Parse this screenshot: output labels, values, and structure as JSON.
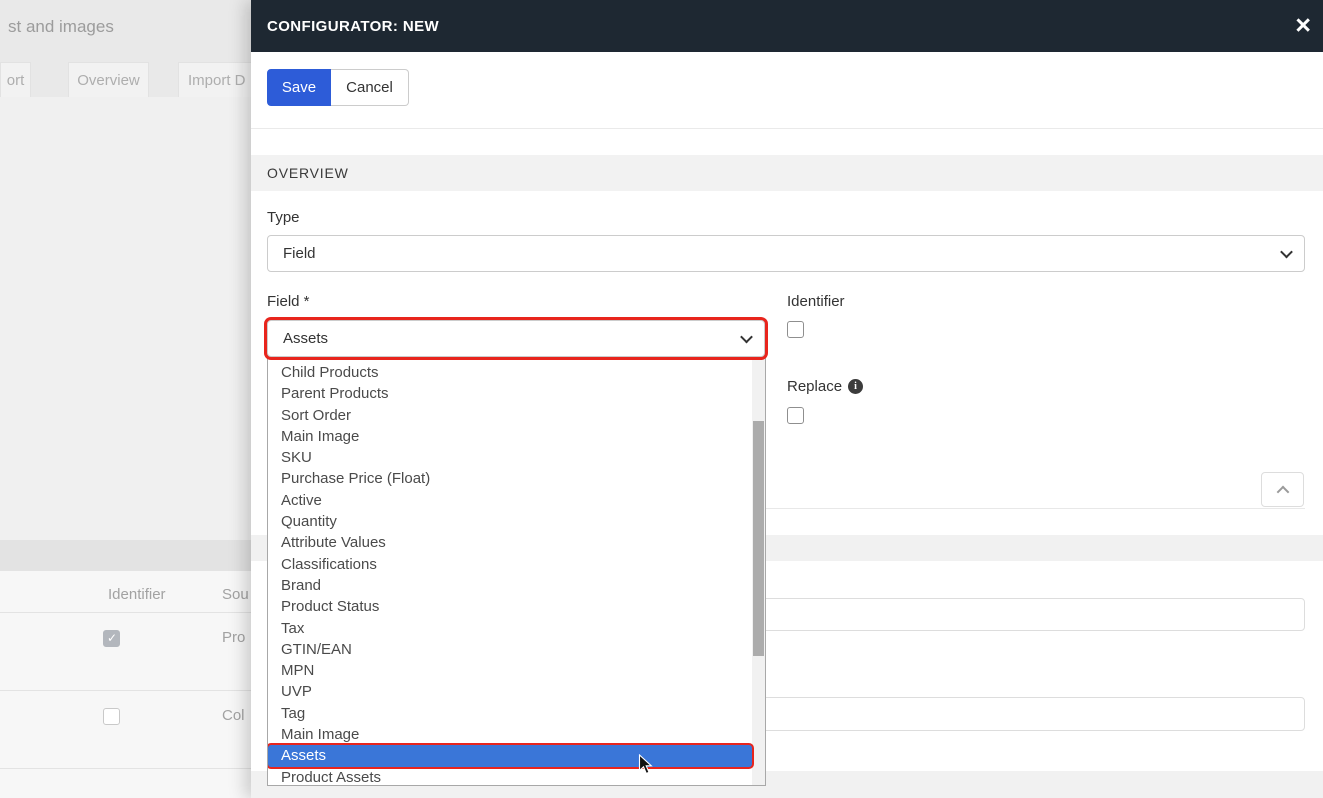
{
  "background": {
    "page_title_fragment": "st and images",
    "tabs": [
      {
        "id": "ort",
        "label": "ort"
      },
      {
        "id": "overview",
        "label": "Overview"
      },
      {
        "id": "import",
        "label": "Import D"
      }
    ],
    "table": {
      "columns": [
        "Identifier",
        "Sou"
      ],
      "rows": [
        {
          "label": "Pro",
          "checked": true
        },
        {
          "label": "Col",
          "checked": false
        }
      ]
    }
  },
  "modal": {
    "title": "CONFIGURATOR: NEW",
    "close_label": "×",
    "toolbar": {
      "save_label": "Save",
      "cancel_label": "Cancel"
    },
    "sections": {
      "overview": "OVERVIEW"
    },
    "type_field": {
      "label": "Type",
      "value": "Field"
    },
    "field_field": {
      "label": "Field *",
      "value": "Assets"
    },
    "identifier": {
      "label": "Identifier",
      "checked": false
    },
    "replace": {
      "label": "Replace",
      "info_icon": "i",
      "checked": false
    },
    "dropdown": {
      "options": [
        "Child Products",
        "Parent Products",
        "Sort Order",
        "Main Image",
        "SKU",
        "Purchase Price (Float)",
        "Active",
        "Quantity",
        "Attribute Values",
        "Classifications",
        "Brand",
        "Product Status",
        "Tax",
        "GTIN/EAN",
        "MPN",
        "UVP",
        "Tag",
        "Main Image",
        "Assets",
        "Product Assets"
      ],
      "selected": "Assets",
      "selected_index": 18
    },
    "colors": {
      "header_bg": "#1e2832",
      "primary_button": "#2d5cd8",
      "dropdown_highlight": "#3a76d8",
      "annotation": "#e8251d"
    }
  }
}
